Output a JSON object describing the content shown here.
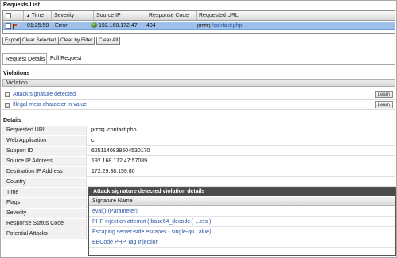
{
  "requests_list": {
    "title": "Requests List",
    "columns": {
      "time": "Time",
      "severity": "Severity",
      "source_ip": "Source IP",
      "response_code": "Response Code",
      "requested_url": "Requested URL"
    },
    "row": {
      "time": "01:25:58",
      "severity": "Error",
      "source_ip": "192.168.172.47",
      "response_code": "404",
      "protocol_tag": "[HTTP]",
      "url": "/contact.php"
    }
  },
  "toolbar": {
    "export": "Export",
    "clear_selected": "Clear Selected",
    "clear_by_filter": "Clear by Filter",
    "clear_all": "Clear All"
  },
  "tabs": {
    "request_details": "Request Details",
    "full_request": "Full Request"
  },
  "violations": {
    "title": "Violations",
    "column": "Violation",
    "learn_label": "Learn",
    "items": [
      "Attack signature detected",
      "Illegal meta character in value"
    ]
  },
  "details": {
    "title": "Details",
    "labels": [
      "Requested URL",
      "Web Application",
      "Support ID",
      "Source IP Address",
      "Destination IP Address",
      "Country",
      "Time",
      "Flags",
      "Severity",
      "Response Status Code",
      "Potential Attacks"
    ],
    "values": {
      "protocol_tag": "[HTTP]",
      "requested_url": "/contact.php",
      "web_application": "c",
      "support_id": "6251140838504530170",
      "source_ip": "192.168.172.47:57089",
      "destination_ip": "172.29.38.159:80"
    }
  },
  "popup": {
    "title": "Attack signature detected violation details",
    "column": "Signature Name",
    "signatures": [
      "eval() (Parameter)",
      "PHP injection attempt ( base64_decode ) ...ers )",
      "Escaping server-side escapes - single-qu...alue)",
      "BBCode PHP Tag Injection"
    ]
  },
  "colors": {
    "selected_row": "#9fc0ea",
    "link": "#2a55a5",
    "popup_title": "#4b4b4b"
  }
}
